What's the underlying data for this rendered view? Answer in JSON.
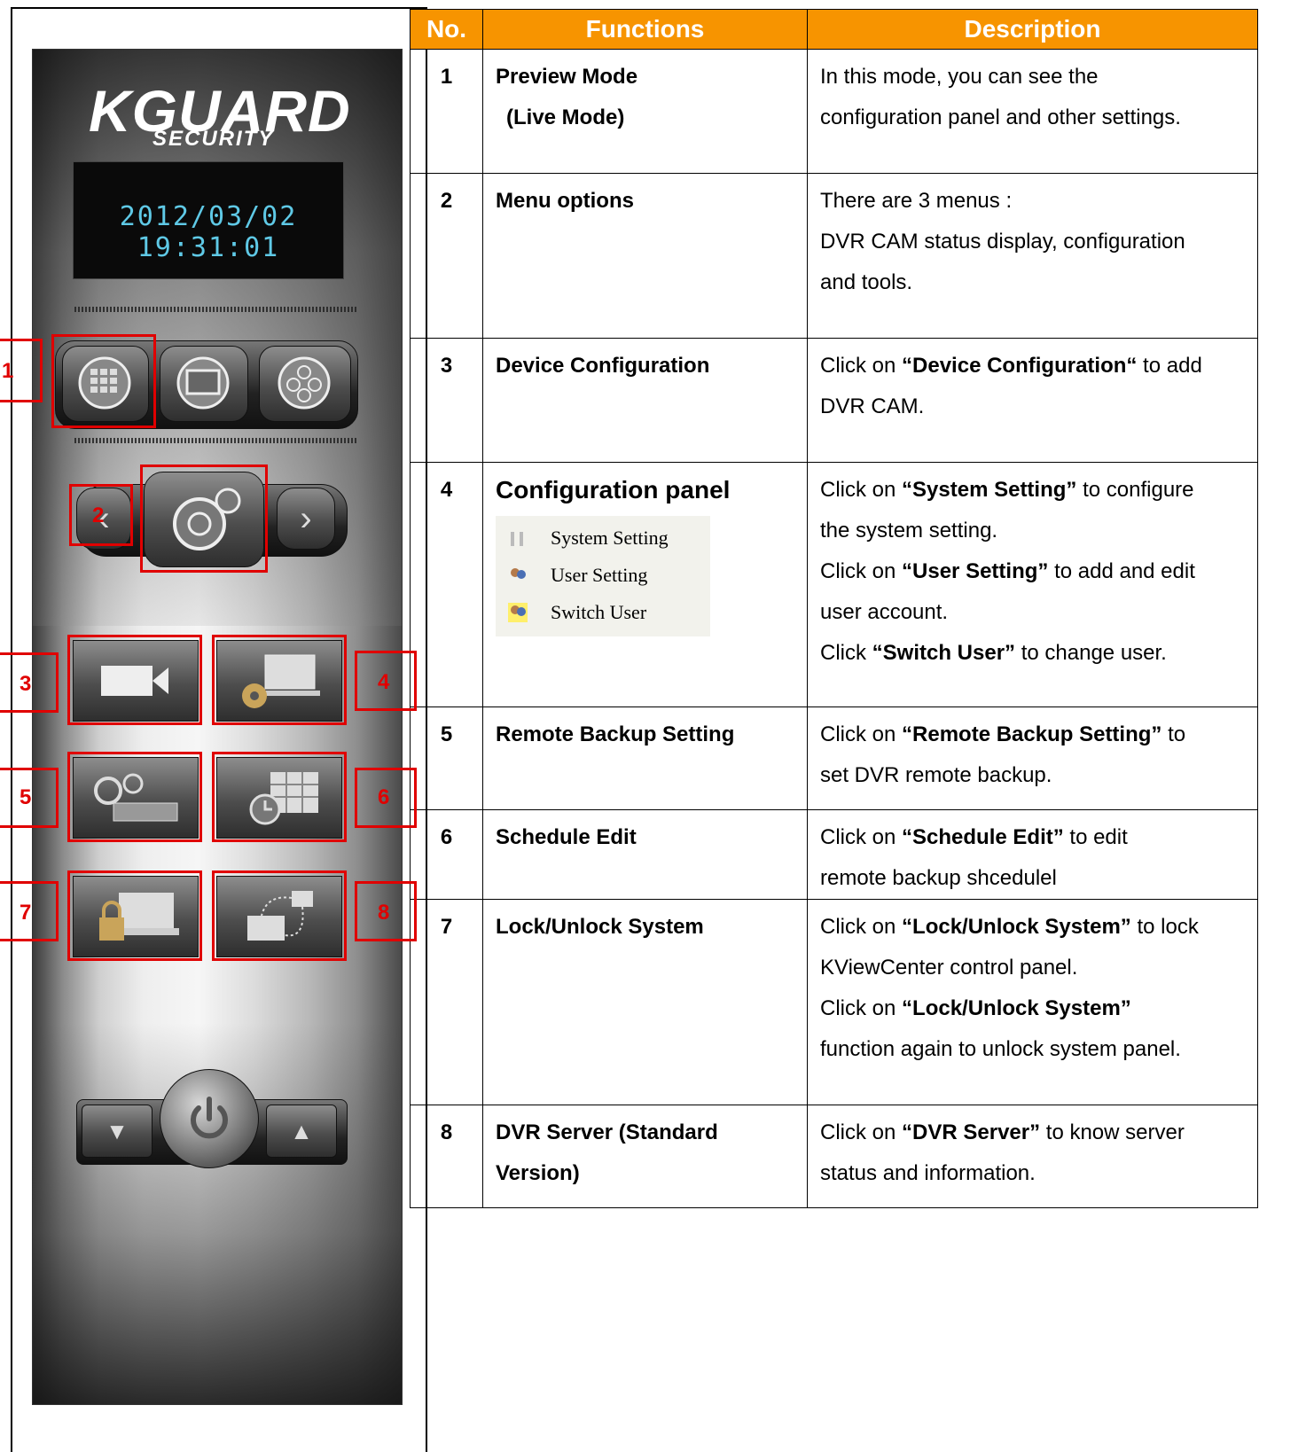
{
  "panel": {
    "logo_main": "KGUARD",
    "logo_sub": "SECURITY",
    "clock_date": "2012/03/02",
    "clock_time": "19:31:01"
  },
  "callouts": [
    "1",
    "2",
    "3",
    "4",
    "5",
    "6",
    "7",
    "8"
  ],
  "table": {
    "headers": [
      "No.",
      "Functions",
      "Description"
    ],
    "rows": [
      {
        "no": "1",
        "func": "Preview Mode",
        "func2": "(Live Mode)",
        "desc": [
          "In this mode, you can see the",
          "configuration panel and other settings."
        ]
      },
      {
        "no": "2",
        "func": "Menu options",
        "desc": [
          "There are 3 menus :",
          "DVR CAM status display, configuration",
          "and tools."
        ]
      },
      {
        "no": "3",
        "func": "Device Configuration",
        "desc_pre": "Click on ",
        "desc_bold": "“Device Configuration“",
        "desc_post": " to add",
        "desc2": "DVR CAM."
      },
      {
        "no": "4",
        "func": "Configuration panel",
        "menu": [
          "System Setting",
          "User Setting",
          "Switch User"
        ],
        "l1_pre": "Click on ",
        "l1_bold": "“System Setting”",
        "l1_post": " to configure",
        "l2": "the system setting.",
        "l3_pre": "Click on ",
        "l3_bold": "“User Setting”",
        "l3_post": " to add and edit",
        "l4": "user account.",
        "l5_pre": "Click ",
        "l5_bold": "“Switch User”",
        "l5_post": " to change user."
      },
      {
        "no": "5",
        "func": "Remote Backup Setting",
        "desc_pre": "Click on ",
        "desc_bold": "“Remote Backup Setting”",
        "desc_post": " to",
        "desc2": "set DVR remote backup."
      },
      {
        "no": "6",
        "func": "Schedule Edit",
        "desc_pre": "Click on ",
        "desc_bold": "“Schedule Edit”",
        "desc_post": " to edit",
        "desc2": "remote backup shcedulel"
      },
      {
        "no": "7",
        "func": "Lock/Unlock System",
        "l1_pre": "Click on ",
        "l1_bold": "“Lock/Unlock System”",
        "l1_post": " to lock",
        "l2": "KViewCenter control panel.",
        "l3_pre": "Click on ",
        "l3_bold": "“Lock/Unlock System”",
        "l4": "function again to unlock system panel."
      },
      {
        "no": "8",
        "func": "DVR Server (Standard",
        "func2": "Version)",
        "desc_pre": "Click on ",
        "desc_bold": "“DVR Server”",
        "desc_post": " to know server",
        "desc2": "status and information."
      }
    ]
  }
}
